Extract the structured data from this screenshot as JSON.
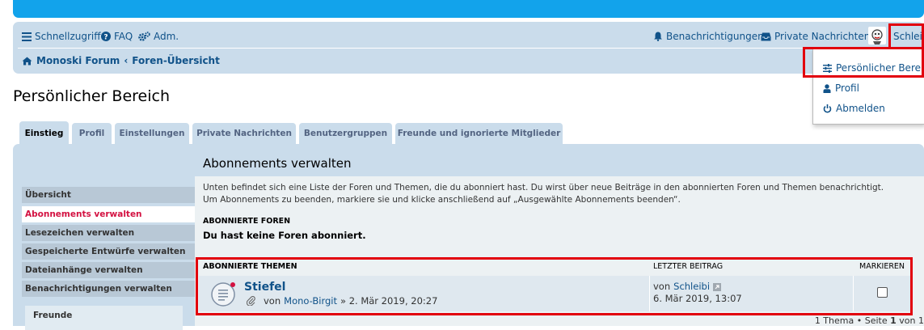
{
  "header": {
    "quick_access": "Schnellzugriff",
    "faq": "FAQ",
    "admin": "Adm.",
    "notifications": "Benachrichtigungen",
    "private_messages": "Private Nachrichten",
    "username": "Schleibi"
  },
  "breadcrumb": {
    "home": "Monoski Forum",
    "forums": "Foren-Übersicht"
  },
  "user_dropdown": {
    "items": [
      {
        "label": "Persönlicher Bereich",
        "icon": "sliders-icon"
      },
      {
        "label": "Profil",
        "icon": "user-icon"
      },
      {
        "label": "Abmelden",
        "icon": "power-icon"
      }
    ]
  },
  "page": {
    "title": "Persönlicher Bereich"
  },
  "tabs": [
    {
      "label": "Einstieg",
      "active": true
    },
    {
      "label": "Profil"
    },
    {
      "label": "Einstellungen"
    },
    {
      "label": "Private Nachrichten"
    },
    {
      "label": "Benutzergruppen"
    },
    {
      "label": "Freunde und ignorierte Mitglieder"
    }
  ],
  "sidebar": {
    "items": [
      {
        "label": "Übersicht"
      },
      {
        "label": "Abonnements verwalten",
        "active": true
      },
      {
        "label": "Lesezeichen verwalten"
      },
      {
        "label": "Gespeicherte Entwürfe verwalten"
      },
      {
        "label": "Dateianhänge verwalten"
      },
      {
        "label": "Benachrichtigungen verwalten"
      }
    ],
    "friends_label": "Freunde"
  },
  "content": {
    "title": "Abonnements verwalten",
    "description_line1": "Unten befindet sich eine Liste der Foren und Themen, die du abonniert hast. Du wirst über neue Beiträge in den abonnierten Foren und Themen benachrichtigt.",
    "description_line2": "Um Abonnements zu beenden, markiere sie und klicke anschließend auf „Ausgewählte Abonnements beenden“.",
    "forums_heading": "ABONNIERTE FOREN",
    "no_forums": "Du hast keine Foren abonniert.",
    "topics_heading": "ABONNIERTE THEMEN",
    "last_post_heading": "LETZTER BEITRAG",
    "mark_heading": "MARKIEREN",
    "topics": [
      {
        "title": "Stiefel",
        "by": "von",
        "author": "Mono-Birgit",
        "date": "» 2. Mär 2019, 20:27",
        "last_by": "von",
        "last_author": "Schleibi",
        "last_date": "6. Mär 2019, 13:07",
        "checked": false
      }
    ],
    "pagination": {
      "count": "1 Thema",
      "sep": "•",
      "page_label": "Seite",
      "page": "1",
      "of": "von",
      "total": "1"
    }
  },
  "colors": {
    "header_blue": "#12a3eb",
    "panel_blue": "#cadceb",
    "link": "#105289",
    "active_red": "#d31141",
    "highlight_red": "#e2000d"
  }
}
